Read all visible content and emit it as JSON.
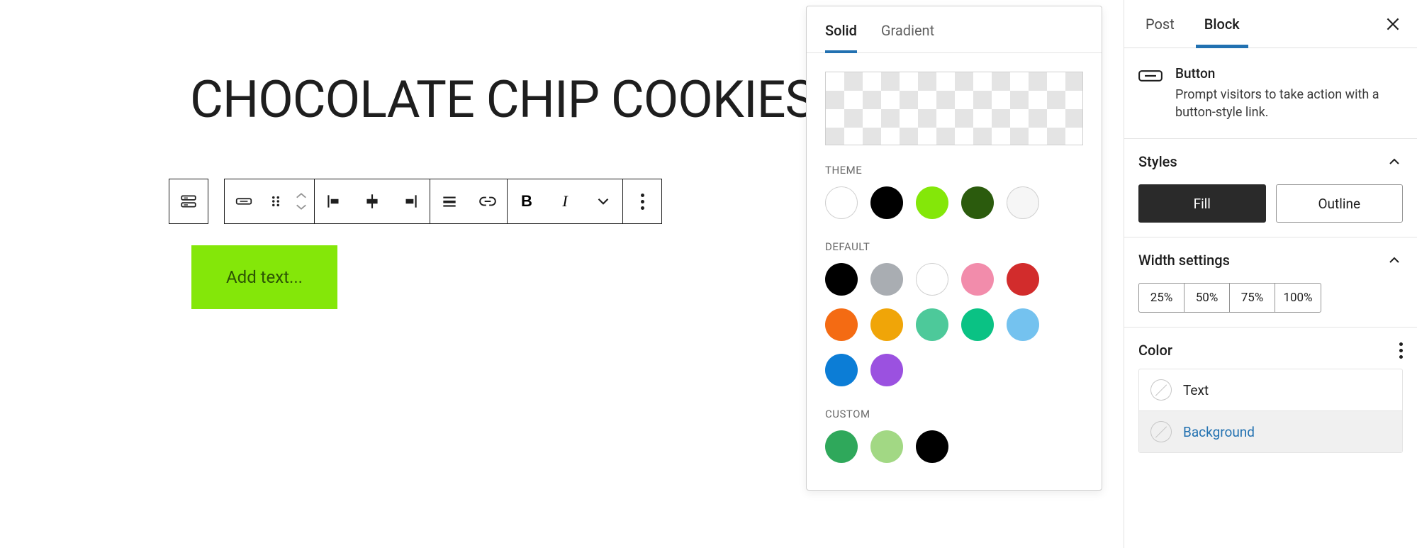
{
  "editor": {
    "post_title": "CHOCOLATE CHIP COOKIES",
    "button_placeholder": "Add text..."
  },
  "color_popover": {
    "tabs": {
      "solid": "Solid",
      "gradient": "Gradient"
    },
    "sections": {
      "theme": "THEME",
      "default": "DEFAULT",
      "custom": "CUSTOM"
    },
    "theme_colors": [
      "#ffffff",
      "#000000",
      "#84e709",
      "#2b5b0d",
      "#f6f6f6"
    ],
    "default_colors": [
      "#000000",
      "#a9adb2",
      "#ffffff",
      "#f28cab",
      "#d22c2c",
      "#f46b13",
      "#f0a508",
      "#4dc99a",
      "#0ac284",
      "#74c2ef",
      "#0c7dd6",
      "#9b51e0"
    ],
    "custom_colors": [
      "#2fa85b",
      "#a2d884",
      "#000000"
    ]
  },
  "sidebar": {
    "tabs": {
      "post": "Post",
      "block": "Block"
    },
    "block": {
      "title": "Button",
      "description": "Prompt visitors to take action with a button-style link."
    },
    "sections": {
      "styles": "Styles",
      "width": "Width settings",
      "color": "Color"
    },
    "style_options": {
      "fill": "Fill",
      "outline": "Outline"
    },
    "width_options": [
      "25%",
      "50%",
      "75%",
      "100%"
    ],
    "color_rows": {
      "text": "Text",
      "background": "Background"
    }
  }
}
